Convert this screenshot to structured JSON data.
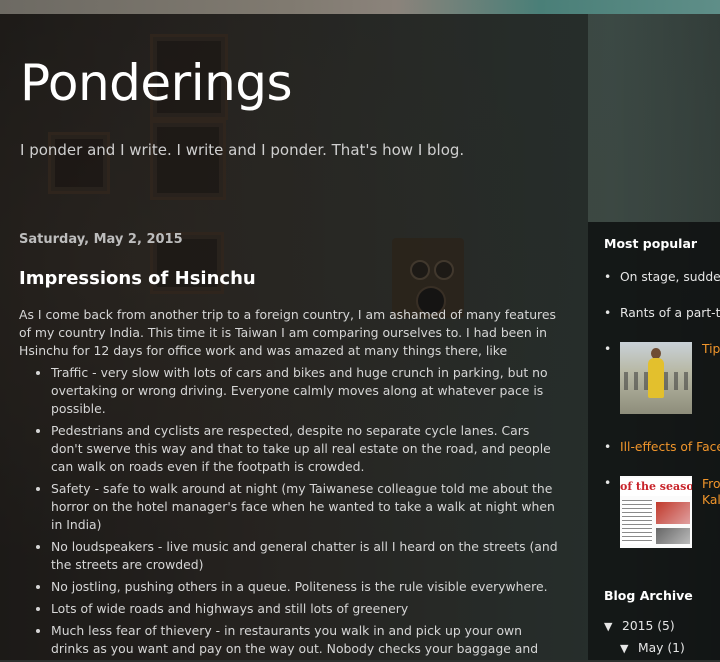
{
  "blog": {
    "title": "Ponderings",
    "description": "I ponder and I write. I write and I ponder. That's how I blog."
  },
  "post": {
    "date": "Saturday, May 2, 2015",
    "title": "Impressions of Hsinchu",
    "intro": "As I come back from another trip to a foreign country, I am ashamed of many features of my country India. This time it is Taiwan I am comparing ourselves to. I had been in Hsinchu for 12 days for office work and was amazed at many things there, like",
    "items": [
      "Traffic - very slow with lots of cars and bikes and huge crunch in parking, but no overtaking or wrong driving. Everyone calmly moves along at whatever pace is possible.",
      "Pedestrians and cyclists are respected, despite no separate cycle lanes. Cars don't swerve this way and that to take up all real estate on the road, and people can walk on roads even if the footpath is crowded.",
      "Safety - safe to walk around at night (my Taiwanese colleague told me about the horror on the hotel manager's face when he wanted to take a walk at night when in India)",
      "No loudspeakers - live music and general chatter is all I heard on the streets (and the streets are crowded)",
      "No jostling, pushing others in a queue. Politeness is the rule visible everywhere.",
      "Lots of wide roads and highways and still lots of greenery",
      "Much less fear of thievery - in restaurants you walk in and pick up your own drinks as you want and pay on the way out. Nobody checks your baggage and"
    ]
  },
  "sidebar": {
    "most_popular": {
      "title": "Most popular",
      "items": [
        {
          "label": "On stage, sudden",
          "bullet": "•"
        },
        {
          "label": "Rants of a part-ti",
          "bullet": "•"
        },
        {
          "label": "Tip",
          "bullet": "•"
        },
        {
          "label": "Ill-effects of Face",
          "bullet": "•"
        },
        {
          "label": "Fro",
          "label2": "Kal",
          "bullet": "•"
        }
      ],
      "thumb2_text": "of the season"
    },
    "archive": {
      "title": "Blog Archive",
      "year": "2015",
      "year_count": "(5)",
      "month": "May",
      "month_count": "(1)",
      "expanded_glyph": "▼"
    }
  },
  "colors": {
    "link": "#f0952b",
    "text": "#d6d6d6",
    "title": "#ffffff"
  }
}
